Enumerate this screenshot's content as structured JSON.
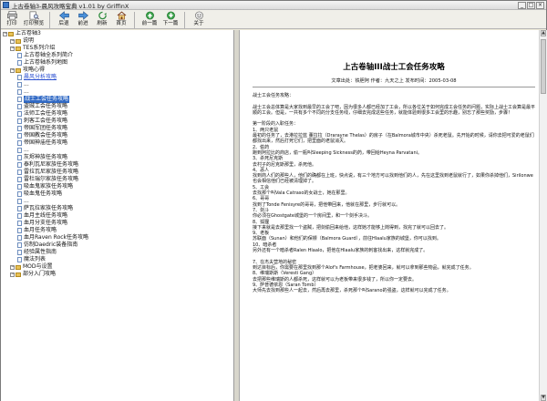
{
  "window": {
    "title": "上古卷轴3-晨风攻略宝典 v1.01 by GriffinX"
  },
  "toolbar": {
    "buttons": [
      {
        "label": "打印",
        "icon": "print-icon"
      },
      {
        "label": "打印预览",
        "icon": "print-preview-icon"
      },
      {
        "label": "后退",
        "icon": "back-icon"
      },
      {
        "label": "前进",
        "icon": "forward-icon"
      },
      {
        "label": "刷新",
        "icon": "refresh-icon"
      },
      {
        "label": "首页",
        "icon": "home-icon"
      },
      {
        "label": "前一篇",
        "icon": "prev-article-icon"
      },
      {
        "label": "下一篇",
        "icon": "next-article-icon"
      },
      {
        "label": "关于",
        "icon": "about-icon"
      }
    ]
  },
  "tree": {
    "items": [
      {
        "label": "上古卷轴3",
        "level": 0,
        "type": "root"
      },
      {
        "label": "说明",
        "level": 1,
        "type": "folder"
      },
      {
        "label": "TES系列介绍",
        "level": 1,
        "type": "folder"
      },
      {
        "label": "上古卷轴全系列简介",
        "level": 2,
        "type": "doc"
      },
      {
        "label": "上古卷轴系列地图",
        "level": 2,
        "type": "doc"
      },
      {
        "label": "攻略心得",
        "level": 1,
        "type": "folder"
      },
      {
        "label": "晨风分析攻略",
        "level": 2,
        "type": "link"
      },
      {
        "label": "...",
        "level": 2,
        "type": "doc"
      },
      {
        "label": "...",
        "level": 2,
        "type": "doc"
      },
      {
        "label": "战士工会任务攻略",
        "level": 2,
        "type": "selected"
      },
      {
        "label": "盗贼工会任务攻略",
        "level": 2,
        "type": "doc"
      },
      {
        "label": "法师工会任务攻略",
        "level": 2,
        "type": "doc"
      },
      {
        "label": "刺客工会任务攻略",
        "level": 2,
        "type": "doc"
      },
      {
        "label": "帝国军团任务攻略",
        "level": 2,
        "type": "doc"
      },
      {
        "label": "帝国教会任务攻略",
        "level": 2,
        "type": "doc"
      },
      {
        "label": "帝国神庙任务攻略",
        "level": 2,
        "type": "doc"
      },
      {
        "label": "...",
        "level": 2,
        "type": "doc"
      },
      {
        "label": "灰烬神族任务攻略",
        "level": 2,
        "type": "doc"
      },
      {
        "label": "泰利瓦尼家族任务攻略",
        "level": 2,
        "type": "doc"
      },
      {
        "label": "雷拉瓦尼家族任务攻略",
        "level": 2,
        "type": "doc"
      },
      {
        "label": "雷杜瑞尔家族任务攻略",
        "level": 2,
        "type": "doc"
      },
      {
        "label": "吸血鬼家族任务攻略",
        "level": 2,
        "type": "doc"
      },
      {
        "label": "吸血鬼任务攻略",
        "level": 2,
        "type": "doc"
      },
      {
        "label": "...",
        "level": 2,
        "type": "doc"
      },
      {
        "label": "萨瓦拉家族任务攻略",
        "level": 2,
        "type": "doc"
      },
      {
        "label": "血月主线任务攻略",
        "level": 2,
        "type": "doc"
      },
      {
        "label": "血月分支任务攻略",
        "level": 2,
        "type": "doc"
      },
      {
        "label": "血月任务攻略",
        "level": 2,
        "type": "doc"
      },
      {
        "label": "血月Raven Rock任务攻略",
        "level": 2,
        "type": "doc"
      },
      {
        "label": "仿制Daedric装备指南",
        "level": 2,
        "type": "doc"
      },
      {
        "label": "经验属性指南",
        "level": 2,
        "type": "doc"
      },
      {
        "label": "魔法列表",
        "level": 2,
        "type": "doc"
      },
      {
        "label": "MOD与设置",
        "level": 1,
        "type": "folder"
      },
      {
        "label": "部分入门攻略",
        "level": 1,
        "type": "folder"
      }
    ]
  },
  "article": {
    "title": "上古卷轴III战士工会任务攻略",
    "meta": "文章出处：铁胆阿 作者：九天之上 发布时间：2005-03-08",
    "body": "战士工会任务攻略：\n\n战士工会总体算是大家找到最早的工会了吧，因为很多人都已经加了工会，所以各位关于如何完成工会任务的问题，实际上战士工会算是最平顺的工会。但是，一共有多个不同的分支任务线，仔细去完成这些任务，就能体验到很多工会里的乐趣，别忘了那些奖励，步骤！\n\n第一阶段的入职任务：\n1、两只老鼠\n最初的任务了，去港拉拉蓝 董拉拉（Drarayne Thelas）的房子（在Balmora城市中央）杀死老鼠。先开始的时候，请你去把可爱的老鼠们都找出来，然后打死它们，把里面的老鼠消灭。\n2、偷药\n跑到阿拉比的商店，偷一瓶叫Sleeping Sickness的药，带回给Heyna Parvatani。\n3、杀死尼克斯\n去村子的尼克斯那里，杀死他。\n4、恶人\n找到商人们的那些人，他们的确都在上班，快点说，有三个地方可以找到他们的人，先在这里找到老鼠就行了，如果你杀掉他们，Sirilonwe也会相信他们已经被清理掉了。\n5、工会\n去找那个叫Vala Catraso的女战士，她在那里。\n6、哥哥\n找到了Tonde Fenisyre的哥哥，把他带回来，他就在那里，步行就可以。\n7、剑斗\n你必须在Ghostgate城堡的一个房间里，和一个剑手决斗。\n8、狐狸\n接下来就是去那里找一个盗贼，把剑偷回来给他，这样她才能够上岗得到，找完了就可以回去了。\n9、老板\n苏联面（Sunan）和他们的保镖（Balmora Guard），前往Hlaalu家族的城堡，你可以找到。\n10、暗杀者\n另外还有一个暗杀者Ralen Hlaalo，把他在Hlaalu家族的刺客找出来，这样就完成了。\n\n7、在杰夫营地的秘密\n到达目标后，你需要在那里找到那个Alof's Farmhouse，把老婆回来，就可以拿到那些物品，就完成了任务。\n8、维瑞斯斯（Veresti Gang）\n去把那些维瑞斯的人都杀死，这样就可以为老板带来很多钱了，所以你一定要去。\n9、萨普德依恩（Saran Tomb）\n大师先去找到那些人一起去，然后再去那里，杀死那个叫Sarano的强盗，这样就可以完成了任务。"
  }
}
